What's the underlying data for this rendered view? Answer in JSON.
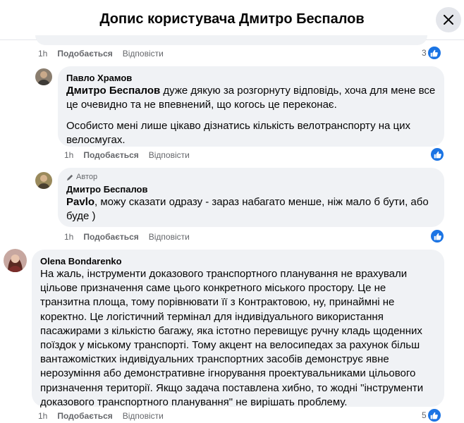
{
  "header": {
    "title": "Допис користувача Дмитро Беспалов"
  },
  "comments": [
    {
      "time": "1h",
      "like": "Подобається",
      "reply": "Відповісти",
      "reaction_count": "3"
    },
    {
      "author": "Павло Храмов",
      "mention": "Дмитро Беспалов",
      "text": " дуже дякую за розгорнуту відповідь, хоча для мене все це очевидно та не впевнений, що когось це переконає.",
      "text2": "Особисто мені лише цікаво дізнатись кількість велотранспорту на цих велосмугах.",
      "time": "1h",
      "like": "Подобається",
      "reply": "Відповісти",
      "reaction_count": ""
    },
    {
      "badge": "Автор",
      "author": "Дмитро Беспалов",
      "mention": "Pavlo",
      "text": ", можу сказати одразу - зараз набагато менше, ніж мало б бути, або буде )",
      "time": "1h",
      "like": "Подобається",
      "reply": "Відповісти",
      "reaction_count": ""
    },
    {
      "author": "Olena Bondarenko",
      "text": "На жаль, інструменти доказового транспортного планування не врахували цільове призначення саме цього конкретного міського простору. Це не транзитна площа, тому порівнювати її з Контрактовою, ну, принаймні не коректно. Це логістичний термінал для індивідуального використання пасажирами з кількістю багажу, яка істотно перевищує ручну кладь щоденних поїздок у міському транспорті. Тому акцент на велосипедах за рахунок більш вантажомістких індивідуальних транспортних засобів демонструє явне нерозуміння або демонстративне ігнорування проектувальниками цільового призначення території. Якщо задача поставлена хибно, то жодні \"інструменти доказового транспортного планування\" не вирішать проблему.",
      "time": "1h",
      "like": "Подобається",
      "reply": "Відповісти",
      "reaction_count": "5"
    }
  ],
  "colors": {
    "like_blue": "#1b74e4",
    "bubble_bg": "#f0f2f5",
    "meta_gray": "#65676b"
  },
  "icons": [
    "close-icon",
    "like-icon",
    "pencil-icon",
    "avatar-pavlo",
    "avatar-dmytro",
    "avatar-olena"
  ]
}
